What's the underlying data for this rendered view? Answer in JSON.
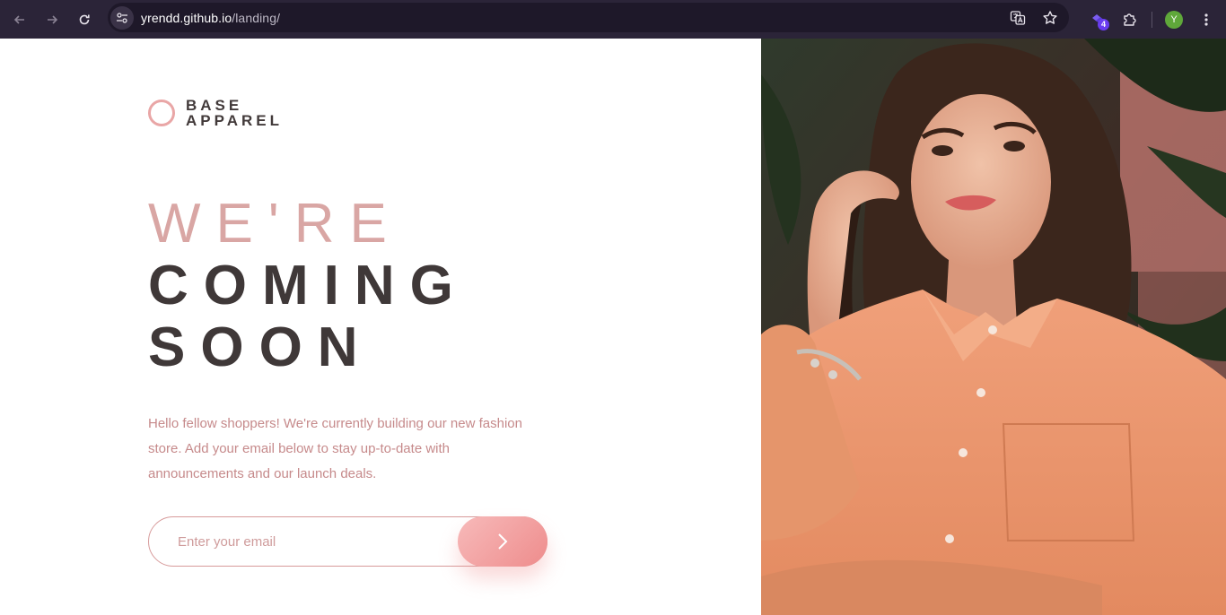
{
  "browser": {
    "url_host": "yrendd.github.io",
    "url_path": "/landing/",
    "extension_badge": "4",
    "profile_initial": "Y"
  },
  "brand": {
    "line1": "BASE",
    "line2": "APPAREL"
  },
  "headline": {
    "line1": "WE'RE",
    "line2": "COMING",
    "line3": "SOON"
  },
  "description": "Hello fellow shoppers! We're currently building our new fashion store. Add your email below to stay up-to-date with announcements and our launch deals.",
  "form": {
    "email_placeholder": "Enter your email",
    "email_value": ""
  },
  "colors": {
    "accent": "#ce9797",
    "dark_text": "#423a3a",
    "gradient_start": "#f8bfbf",
    "gradient_end": "#ee8c8c"
  }
}
